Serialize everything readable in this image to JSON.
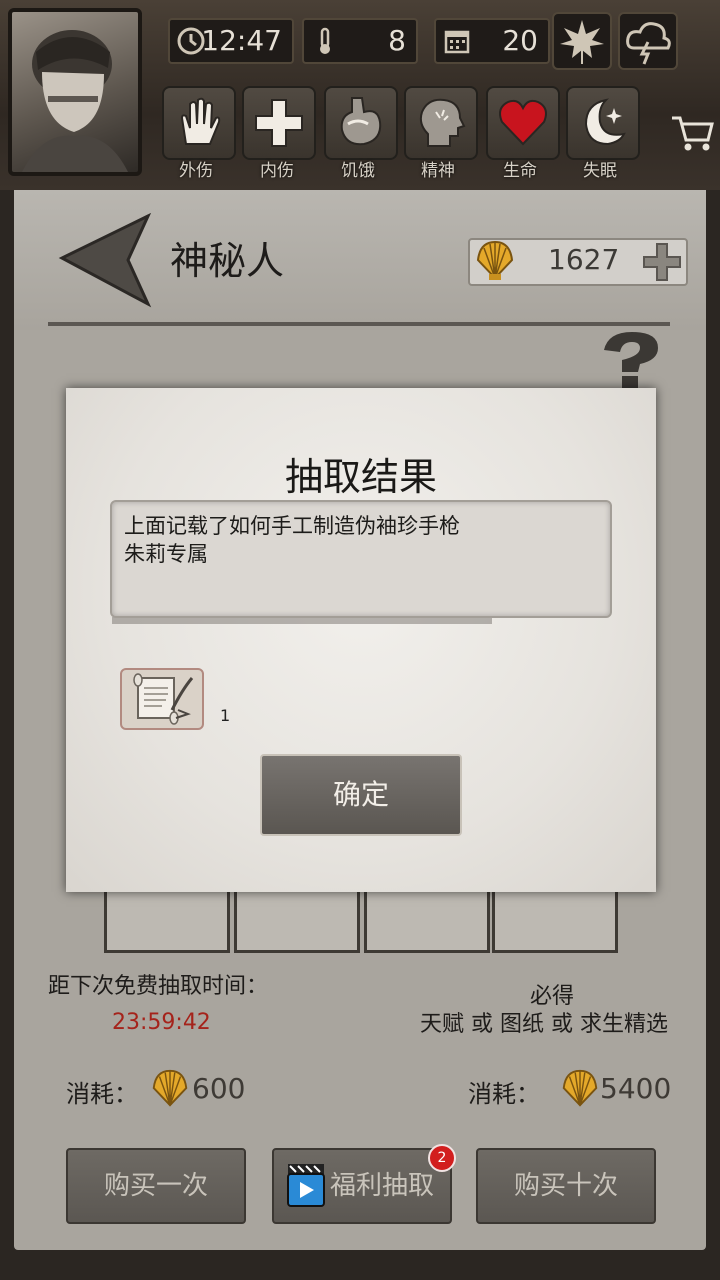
{
  "hud": {
    "time": "12:47",
    "temperature": "8",
    "day": "20",
    "icons": [
      "clock-icon",
      "thermometer-icon",
      "calendar-icon",
      "leaf-icon",
      "storm-cloud-icon"
    ]
  },
  "status": [
    {
      "label": "外伤",
      "icon": "hand-icon"
    },
    {
      "label": "内伤",
      "icon": "cross-icon"
    },
    {
      "label": "饥饿",
      "icon": "stomach-icon"
    },
    {
      "label": "精神",
      "icon": "head-icon"
    },
    {
      "label": "生命",
      "icon": "heart-icon"
    },
    {
      "label": "失眠",
      "icon": "moon-icon"
    }
  ],
  "header": {
    "title": "神秘人",
    "shells": "1627"
  },
  "gacha": {
    "free_label": "距下次免费抽取时间：",
    "free_timer": "23:59:42",
    "guarantee_1": "必得",
    "guarantee_2": "天赋 或 图纸 或 求生精选",
    "cost_label": "消耗：",
    "cost_single": "600",
    "cost_ten": "5400",
    "buy_once": "购买一次",
    "welfare": "福利抽取",
    "welfare_badge": "2",
    "buy_ten": "购买十次"
  },
  "modal": {
    "title": "抽取结果",
    "line1": "上面记载了如何手工制造伪袖珍手枪",
    "line2": "朱莉专属",
    "item_count": "1",
    "confirm": "确定"
  },
  "colors": {
    "timer_red": "#a5231b",
    "heart_red": "#c8141e",
    "badge_red": "#d21e1e"
  }
}
